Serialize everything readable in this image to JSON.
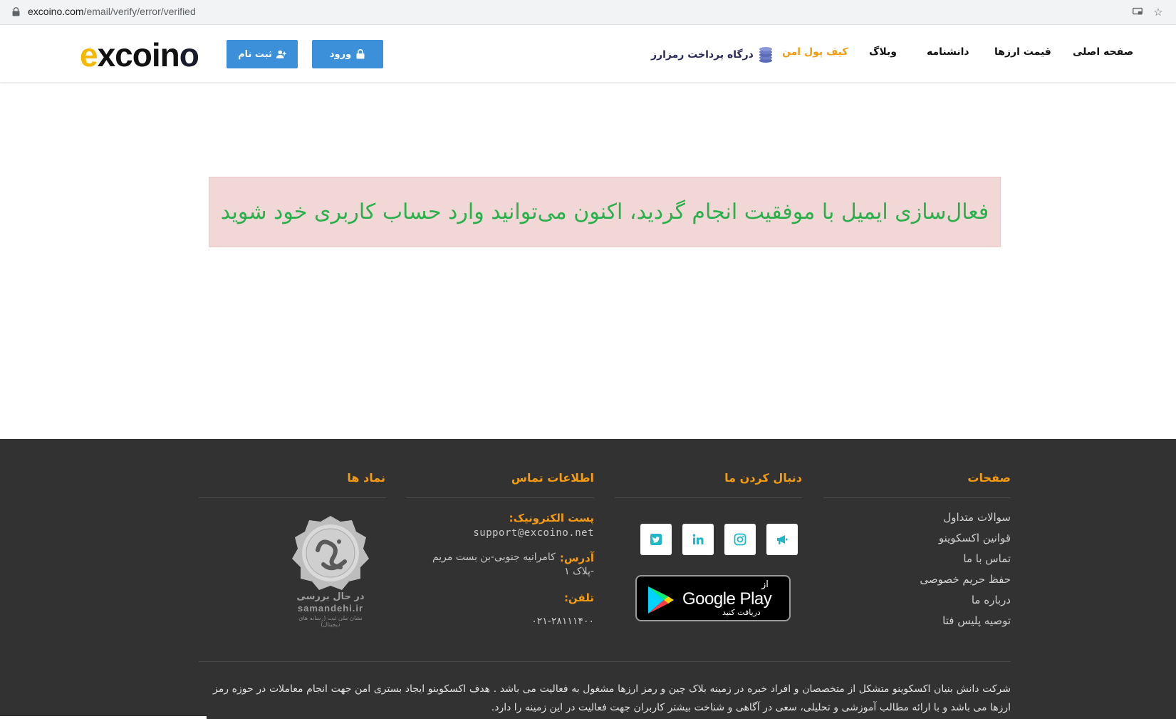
{
  "browser": {
    "url_host": "excoino.com",
    "url_path": "/email/verify/error/verified"
  },
  "header": {
    "logo_text": "excoino",
    "login_label": "ورود",
    "register_label": "ثبت نام",
    "nav": {
      "home": "صفحه اصلی",
      "prices": "قیمت ارزها",
      "encyclopedia": "دانشنامه",
      "blog": "وبلاگ",
      "wallet": "کیف پول امن",
      "gateway": "درگاه پرداخت رمزارز"
    }
  },
  "alert": {
    "message": "فعال‌سازی ایمیل با موفقیت انجام گردید، اکنون می‌توانید وارد حساب کاربری خود شوید"
  },
  "footer": {
    "pages_title": "صفحات",
    "pages": [
      "سوالات متداول",
      "قوانین اکسکوینو",
      "تماس با ما",
      "حفظ حریم خصوصی",
      "درباره ما",
      "توصیه پلیس فتا"
    ],
    "follow_title": "دنبال کردن ما",
    "google_play": {
      "from": "از",
      "brand": "Google Play",
      "get": "دریافت کنید"
    },
    "contact_title": "اطلاعات تماس",
    "email_label": "پست الکترونیک:",
    "email_value": "support@excoino.net",
    "address_label": "آدرس:",
    "address_line1": "کامرانیه جنوبی-بن بست مریم",
    "address_line2": "-پلاک ۱",
    "phone_label": "تلفن:",
    "phone_value": "۰۲۱-۲۸۱۱۱۴۰۰",
    "badges_title": "نماد ها",
    "seal_status": "در حال بررسی",
    "seal_site": "samandehi.ir",
    "seal_caption": "نشان ملی ثبت (رسانه های دیجیتال)",
    "about_text": "شرکت دانش بنیان اکسکوینو متشکل از متخصصان و افراد خبره در زمینه بلاک چین و رمز ارزها مشغول به فعالیت می باشد . هدف اکسکوینو ایجاد بستری امن جهت انجام معاملات در حوزه رمز ارزها می باشد و با ارائه مطالب آموزشی و تحلیلی، سعی در آگاهی و شناخت بیشتر کاربران جهت فعالیت در این زمینه را دارد."
  },
  "colors": {
    "accent_orange": "#f39c12",
    "button_blue": "#3c8fd9",
    "success_green": "#2ab04a",
    "alert_bg": "#f2d7d7",
    "footer_bg": "#323232",
    "social_icon": "#1fb6c9"
  },
  "icons": {
    "lock": "lock-icon",
    "user_plus": "user-plus-icon",
    "coins": "coins-icon",
    "twitter": "twitter-icon",
    "linkedin": "linkedin-icon",
    "instagram": "instagram-icon",
    "megaphone": "megaphone-icon",
    "play": "google-play-icon"
  }
}
